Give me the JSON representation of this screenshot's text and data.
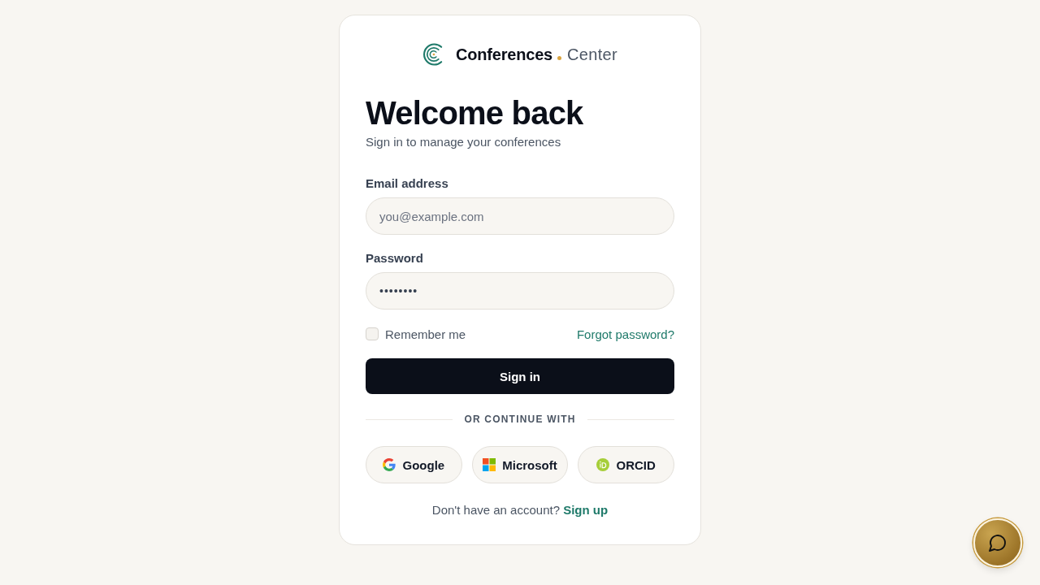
{
  "brand": {
    "name": "Conferences",
    "suffix": "Center"
  },
  "heading": {
    "title": "Welcome back",
    "subtitle": "Sign in to manage your conferences"
  },
  "form": {
    "fields": [
      {
        "kind": "email",
        "label": "Email address",
        "placeholder": "you@example.com"
      },
      {
        "kind": "password",
        "label": "Password",
        "value": "••••••••"
      }
    ],
    "remember": {
      "label": "Remember me",
      "checked": false
    },
    "forgot_link": "Forgot password?",
    "submit": "Sign in"
  },
  "divider": "OR CONTINUE WITH",
  "providers": [
    {
      "kind": "google",
      "label": "Google"
    },
    {
      "kind": "microsoft",
      "label": "Microsoft"
    },
    {
      "kind": "orcid",
      "label": "ORCID"
    }
  ],
  "signup": {
    "prompt": "Don't have an account?",
    "link": "Sign up"
  }
}
